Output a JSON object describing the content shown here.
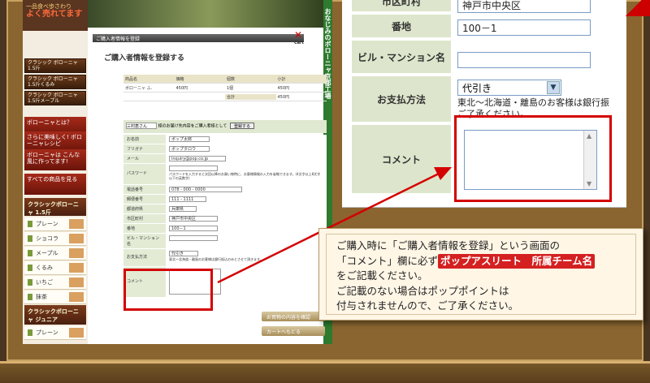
{
  "left": {
    "promo": {
      "line1": "一品食べ歩さわり",
      "line2": "よく売れてます"
    },
    "nav_buttons": [
      "クラシック ボローニャ1.5斤",
      "クラシック ボローニャ1.5斤くるみ",
      "クラシック ボローニャ1.5斤メープル"
    ],
    "nav_red": [
      "ボローニャとは？",
      "さらに美味しく! ボローニャレシピ",
      "ボローニャは こんな風に作ってます!",
      "すべての商品を見る"
    ],
    "cat1_title": "クラシックボローニャ 1.5斤",
    "cat1_items": [
      "プレーン",
      "ショコラ",
      "メープル",
      "くるみ",
      "いちご",
      "抹茶"
    ],
    "cat2_title": "クラシックボローニャ ジュニア",
    "cat2_items": [
      "プレーン",
      "ショコラ"
    ],
    "vertical_text": "おなじみのボローニャ京都工場",
    "section_bar": "ご購入者情報を登録",
    "cart_label": "Cart",
    "title": "ご購入者情報を登録する",
    "cart_table": {
      "headers": [
        "商品名",
        "価格",
        "個数",
        "小計"
      ],
      "row": [
        "ボローニャ ふ.",
        "450円",
        "1個",
        "450円"
      ],
      "total_label": "合計",
      "total_value": "450円"
    },
    "chooser_select": "三村恵さん",
    "chooser_text": "様のお届け先内容をご購入者様として",
    "chooser_button": "登録する",
    "form": [
      {
        "label": "お名前",
        "value": "ポップ太郎"
      },
      {
        "label": "フリガナ",
        "value": "ポップタロウ"
      },
      {
        "label": "メール",
        "value": "inquiry@pop.co.jp"
      },
      {
        "label": "パスワード",
        "value": "パスワードを入力すると次回以降のお買い物時に、お客様情報の入力を省略できます。(4文字以上8文字以下の英数字)"
      },
      {
        "label": "電話番号",
        "value": "078 - 000 - 0000"
      },
      {
        "label": "郵便番号",
        "value": "111 - 1111"
      },
      {
        "label": "都道府県",
        "value": "兵庫県"
      },
      {
        "label": "市区町村",
        "value": "神戸市中央区"
      },
      {
        "label": "番地",
        "value": "100－1"
      },
      {
        "label": "ビル・マンション名",
        "value": ""
      },
      {
        "label": "お支払方法",
        "value": "代引き"
      },
      {
        "label": "コメント",
        "value": ""
      }
    ],
    "payment_note": "東北～北海道・離島のお客様は銀行振込のみとさせて頂きます。",
    "confirm_button": "お買物の内容を確認",
    "back_button": "カートへもどる"
  },
  "zoom": {
    "partial_label": "市区町村",
    "partial_value": "神戸市中央区",
    "address_label": "番地",
    "address_value": "100－1",
    "building_label": "ビル・マンション名",
    "building_value": "",
    "payment_label": "お支払方法",
    "payment_value": "代引き",
    "payment_note_line1": "東北～北海道・離島のお客様は銀行振",
    "payment_note_line2": "ご了承ください。",
    "comment_label": "コメント"
  },
  "callout": {
    "line1": "ご購入時に「ご購入者情報を登録」という画面の",
    "line2a": "「コメント」欄に必ず",
    "team": "ポップアスリート　所属チーム名",
    "line3": "をご記載ください。",
    "line4": "ご記載のない場合はポップポイントは",
    "line5": "付与されませんので、ご了承ください。"
  },
  "colors": {
    "highlight": "#d40000",
    "label_bg": "#dde6cc",
    "team_badge": "#d42020",
    "frame": "#8a6530"
  }
}
